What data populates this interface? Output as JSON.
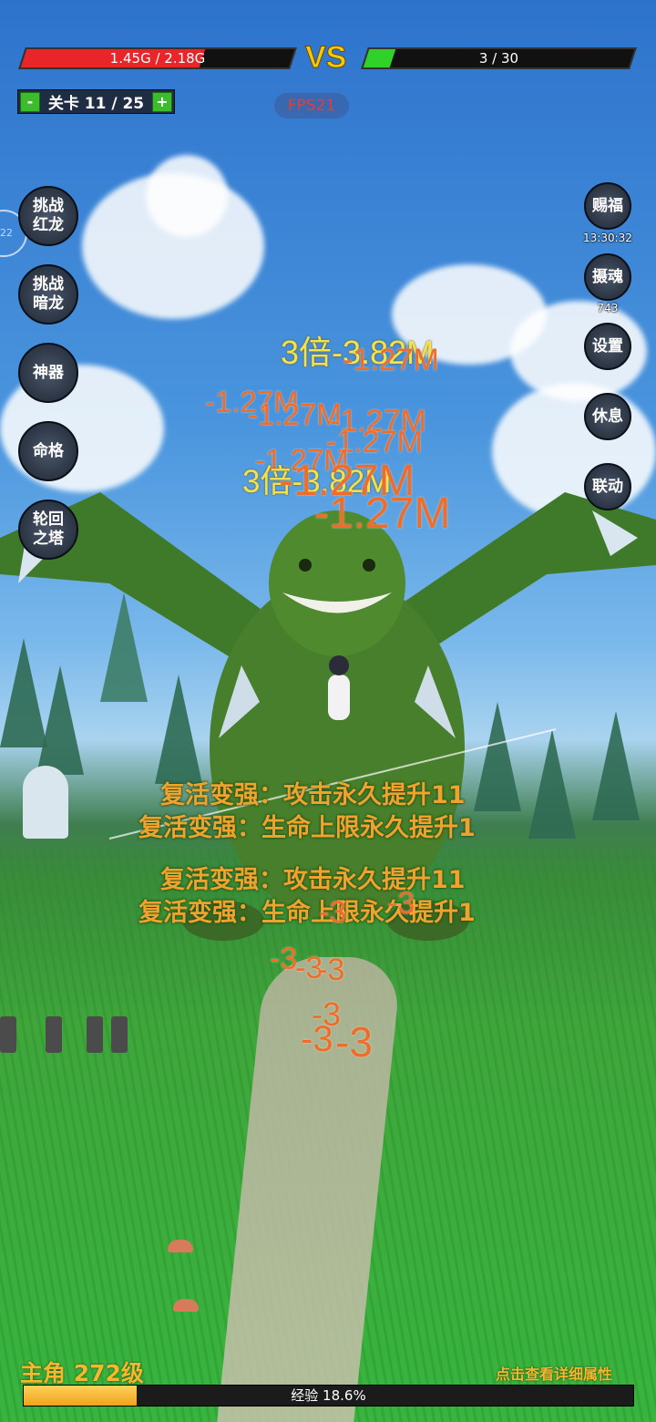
{
  "hud": {
    "player_hp": "1.45G / 2.18G",
    "player_hp_fraction": 0.665,
    "player_hp_color": "#e8262a",
    "vs": "VS",
    "enemy_count": "3 / 30",
    "enemy_fraction": 0.1,
    "enemy_color": "#2fd12a",
    "level_minus": "-",
    "level_label": "关卡 11 / 25",
    "level_plus": "+",
    "fps": "FPS21"
  },
  "left_menu": {
    "edge_badge": "22",
    "challenge_red": "挑战\n红龙",
    "challenge_dark": "挑战\n暗龙",
    "artifact": "神器",
    "fate": "命格",
    "tower": "轮回\n之塔"
  },
  "right_menu": {
    "blessing": "赐福",
    "blessing_timer": "13:30:32",
    "soul": "摄魂",
    "soul_count": "743",
    "settings": "设置",
    "rest": "休息",
    "link": "联动"
  },
  "combat_text": {
    "crit1": "3倍-3.82M",
    "crit2": "3倍-3.82M",
    "dmg1": "-1.27M",
    "dmg2": "-1.27M",
    "dmg3": "-1.27M",
    "dmg4": "-1.27M",
    "dmg5": "-1.27M",
    "dmg6": "-1.27M",
    "dmg7": "-1.27M",
    "dmg8": "-1.27M",
    "small1": "-3",
    "small2": "-3",
    "small3": "-3",
    "small4": "-3",
    "small5": "-3",
    "small6": "-3",
    "small7": "-3",
    "small8": "-3"
  },
  "buffs": {
    "line1": "复活变强：攻击永久提升11",
    "line2": "复活变强：生命上限永久提升1",
    "line3": "复活变强：攻击永久提升11",
    "line4": "复活变强：生命上限永久提升1"
  },
  "footer": {
    "player_name": "主角 272级",
    "detail_link": "点击查看详细属性",
    "exp_text": "经验 18.6%",
    "exp_fraction": 0.186
  }
}
